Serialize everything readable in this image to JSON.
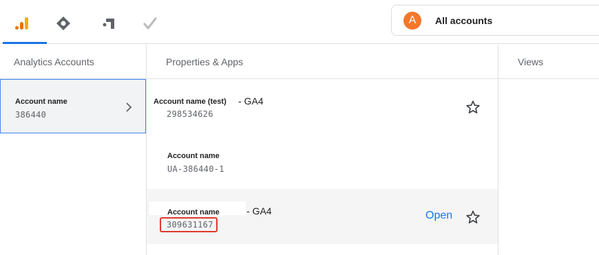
{
  "header": {
    "products": [
      {
        "name": "analytics",
        "icon": "analytics-bar-icon",
        "active": true
      },
      {
        "name": "tag-manager",
        "icon": "tag-manager-diamond-icon",
        "active": false
      },
      {
        "name": "optimize",
        "icon": "optimize-icon",
        "active": false
      },
      {
        "name": "surveys",
        "icon": "checkmark-icon",
        "active": false
      }
    ],
    "account_picker": {
      "avatar_letter": "A",
      "label": "All accounts",
      "avatar_color": "#f4772b"
    }
  },
  "columns": {
    "accounts_header": "Analytics Accounts",
    "properties_header": "Properties & Apps",
    "views_header": "Views"
  },
  "accounts": [
    {
      "name": "Account name",
      "id": "386440",
      "selected": true
    }
  ],
  "properties": [
    {
      "name": "Account name (test)",
      "suffix": "- GA4",
      "id": "298534626",
      "starred": false,
      "show_open": false
    },
    {
      "name": "Account name",
      "suffix": "",
      "id": "UA-386440-1",
      "starred": false,
      "show_open": false
    },
    {
      "name": "Account name",
      "suffix": "- GA4",
      "id": "309631167",
      "starred": false,
      "show_open": true,
      "open_label": "Open",
      "highlighted": true
    }
  ],
  "colors": {
    "accent": "#1a73e8",
    "highlight": "#e0382c",
    "selected_border": "#4285f4"
  }
}
